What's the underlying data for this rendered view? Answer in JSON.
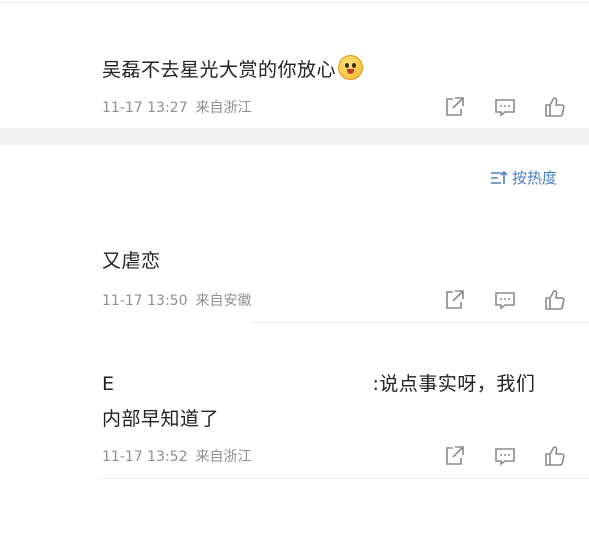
{
  "comments": [
    {
      "text": "吴磊不去星光大赏的你放心",
      "emoji_icon": "tongue-out-face-emoji",
      "time": "11-17 13:27",
      "location": "来自浙江"
    },
    {
      "text": "又虐恋",
      "time": "11-17 13:50",
      "location": "来自安徽"
    },
    {
      "text_prefix": "E",
      "text_line1_suffix": ":说点事实呀，我们",
      "text_line2": "内部早知道",
      "text_line2_tail": "了",
      "time": "11-17 13:52",
      "location": "来自浙江"
    }
  ],
  "sort": {
    "label": "按热度",
    "icon": "sort-lines-icon"
  },
  "action_icons": [
    "share-icon",
    "comment-icon",
    "like-icon"
  ],
  "colors": {
    "text": "#222222",
    "meta": "#8f8f8f",
    "accent": "#4a7fc1",
    "band": "#f2f2f2",
    "divider": "#ececec"
  }
}
